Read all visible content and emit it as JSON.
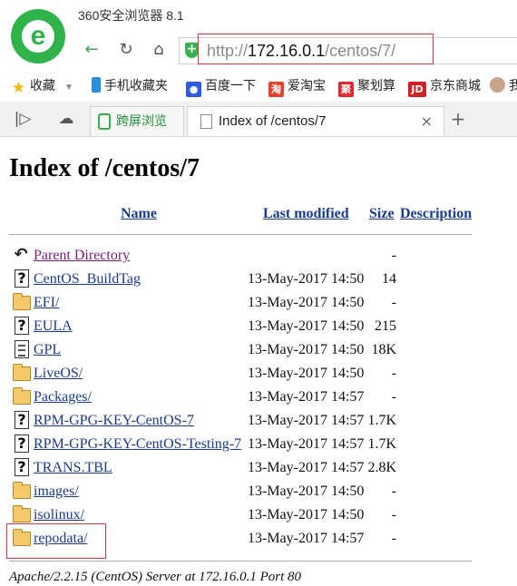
{
  "browser": {
    "app_title": "360安全浏览器 8.1",
    "logo_letter": "e",
    "url_prefix": "http://",
    "url_host": "172.16.0.1",
    "url_path": "/centos/7/",
    "bookmarks": [
      {
        "label": "收藏",
        "icon": "star-icon",
        "color": "#f2b705"
      },
      {
        "label": "手机收藏夹",
        "icon": "phone-icon",
        "color": "#2a8de0"
      },
      {
        "label": "百度一下",
        "icon": "baidu-paw-icon",
        "color": "#2d5be3"
      },
      {
        "label": "爱淘宝",
        "icon": "taobao-icon",
        "color": "#e8402d"
      },
      {
        "label": "聚划算",
        "icon": "juhuasuan-icon",
        "color": "#e0282f"
      },
      {
        "label": "京东商城",
        "icon": "jd-icon",
        "color": "#d11f24"
      },
      {
        "label": "我",
        "icon": "avatar-icon",
        "color": "#c9a38a"
      }
    ],
    "tabs": [
      {
        "label": "跨屏浏览",
        "icon": "cross-screen-icon"
      },
      {
        "label": "Index of /centos/7",
        "icon": "document-icon"
      }
    ],
    "new_tab_symbol": "+",
    "close_symbol": "×"
  },
  "page": {
    "title": "Index of /centos/7",
    "columns": {
      "name": "Name",
      "last_modified": "Last modified",
      "size": "Size",
      "description": "Description"
    },
    "rows": [
      {
        "icon": "back",
        "name": "Parent Directory",
        "date": "",
        "size": "-"
      },
      {
        "icon": "unknown",
        "name": "CentOS_BuildTag",
        "date": "13-May-2017 14:50",
        "size": "14"
      },
      {
        "icon": "folder",
        "name": "EFI/",
        "date": "13-May-2017 14:50",
        "size": "-"
      },
      {
        "icon": "unknown",
        "name": "EULA",
        "date": "13-May-2017 14:50",
        "size": "215"
      },
      {
        "icon": "text",
        "name": "GPL",
        "date": "13-May-2017 14:50",
        "size": "18K"
      },
      {
        "icon": "folder",
        "name": "LiveOS/",
        "date": "13-May-2017 14:50",
        "size": "-"
      },
      {
        "icon": "folder",
        "name": "Packages/",
        "date": "13-May-2017 14:57",
        "size": "-"
      },
      {
        "icon": "unknown",
        "name": "RPM-GPG-KEY-CentOS-7",
        "date": "13-May-2017 14:57",
        "size": "1.7K"
      },
      {
        "icon": "unknown",
        "name": "RPM-GPG-KEY-CentOS-Testing-7",
        "date": "13-May-2017 14:57",
        "size": "1.7K"
      },
      {
        "icon": "unknown",
        "name": "TRANS.TBL",
        "date": "13-May-2017 14:57",
        "size": "2.8K"
      },
      {
        "icon": "folder",
        "name": "images/",
        "date": "13-May-2017 14:50",
        "size": "-"
      },
      {
        "icon": "folder",
        "name": "isolinux/",
        "date": "13-May-2017 14:50",
        "size": "-"
      },
      {
        "icon": "folder",
        "name": "repodata/",
        "date": "13-May-2017 14:57",
        "size": "-"
      }
    ],
    "footer": "Apache/2.2.15 (CentOS) Server at 172.16.0.1 Port 80"
  },
  "colors": {
    "link": "#1a3c8e",
    "visited": "#7b1e7a",
    "highlight_box": "#e0333a",
    "brand_green": "#2fb34a"
  }
}
